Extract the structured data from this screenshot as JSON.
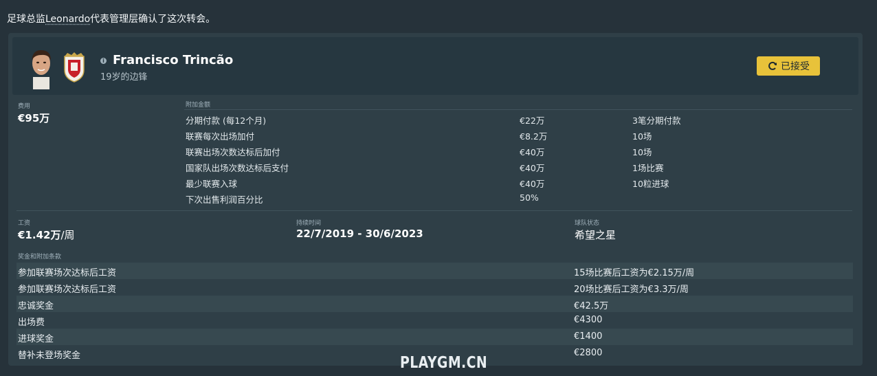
{
  "message": {
    "prefix": "足球总监",
    "director": "Leonardo",
    "suffix": "代表管理层确认了这次转会。"
  },
  "player": {
    "name": "Francisco Trincão",
    "subtitle": "19岁的边锋",
    "status_button": "已接受"
  },
  "fee": {
    "label": "费用",
    "value": "€95万"
  },
  "clauses": {
    "label": "附加金额",
    "rows": [
      {
        "name": "分期付款 (每12个月)",
        "amount": "€22万",
        "condition": "3笔分期付款"
      },
      {
        "name": "联赛每次出场加付",
        "amount": "€8.2万",
        "condition": "10场"
      },
      {
        "name": "联赛出场次数达标后加付",
        "amount": "€40万",
        "condition": "10场"
      },
      {
        "name": "国家队出场次数达标后支付",
        "amount": "€40万",
        "condition": "1场比赛"
      },
      {
        "name": "最少联赛入球",
        "amount": "€40万",
        "condition": "10粒进球"
      },
      {
        "name": "下次出售利润百分比",
        "amount": "50%",
        "condition": ""
      }
    ]
  },
  "wage": {
    "label": "工资",
    "value": "€1.42万",
    "unit": "/周"
  },
  "duration": {
    "label": "持续时间",
    "value": "22/7/2019 - 30/6/2023"
  },
  "squad_status": {
    "label": "球队状态",
    "value": "希望之星"
  },
  "bonuses": {
    "label": "奖金和附加条款",
    "rows": [
      {
        "name": "参加联赛场次达标后工资",
        "value": "15场比赛后工资为€2.15万/周"
      },
      {
        "name": "参加联赛场次达标后工资",
        "value": "20场比赛后工资为€3.3万/周"
      },
      {
        "name": "忠诚奖金",
        "value": "€42.5万"
      },
      {
        "name": "出场费",
        "value": "€4300"
      },
      {
        "name": "进球奖金",
        "value": "€1400"
      },
      {
        "name": "替补未登场奖金",
        "value": "€2800"
      }
    ]
  },
  "watermark": "PLAYGM.CN",
  "colors": {
    "accent": "#e8c23a",
    "panel": "#2f3f47",
    "background": "#26323a"
  },
  "icons": {
    "info": "info-icon",
    "refresh": "refresh-icon",
    "club": "sc-braga-crest"
  }
}
